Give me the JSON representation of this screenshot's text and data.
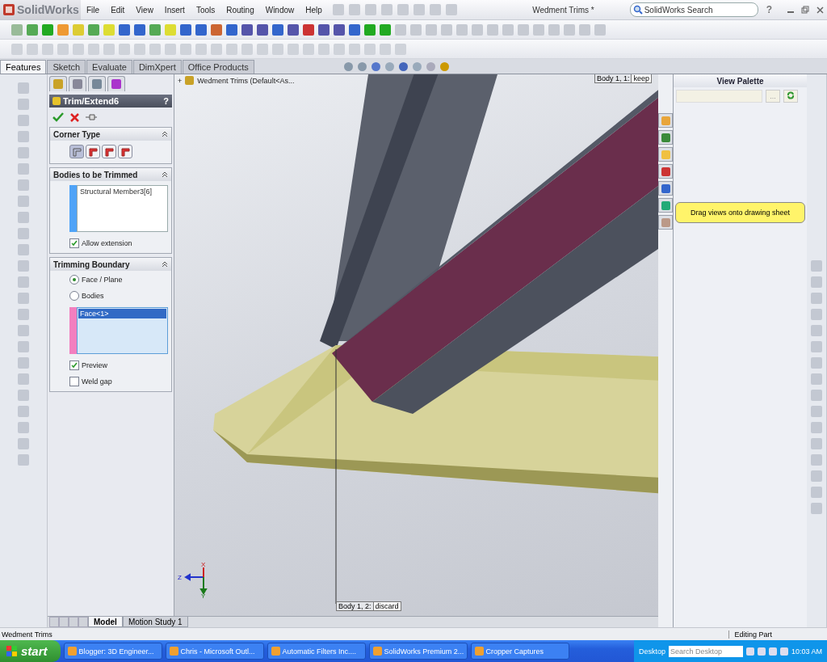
{
  "app": {
    "logo": "SolidWorks",
    "title": "Wedment Trims *",
    "search_placeholder": "SolidWorks Search",
    "help": "?"
  },
  "menu": [
    "File",
    "Edit",
    "View",
    "Insert",
    "Tools",
    "Routing",
    "Window",
    "Help"
  ],
  "command_tabs": [
    {
      "label": "Features",
      "selected": true
    },
    {
      "label": "Sketch",
      "selected": false
    },
    {
      "label": "Evaluate",
      "selected": false
    },
    {
      "label": "DimXpert",
      "selected": false
    },
    {
      "label": "Office Products",
      "selected": false
    }
  ],
  "property_manager": {
    "title": "Trim/Extend6",
    "help": "?",
    "sections": [
      {
        "kind": "corner_type",
        "title": "Corner Type",
        "options": [
          {
            "selected": true
          },
          {
            "selected": false
          },
          {
            "selected": false
          },
          {
            "selected": false
          }
        ]
      },
      {
        "kind": "bodies",
        "title": "Bodies to be Trimmed",
        "color": "#4fa3f7",
        "items": [
          {
            "label": "Structural Member3[6]",
            "selected": false
          }
        ],
        "checkboxes": [
          {
            "label": "Allow extension",
            "checked": true
          }
        ]
      },
      {
        "kind": "boundary",
        "title": "Trimming Boundary",
        "color": "#f27fbf",
        "radios": [
          {
            "label": "Face / Plane",
            "selected": true
          },
          {
            "label": "Bodies",
            "selected": false
          }
        ],
        "items": [
          {
            "label": "Face<1>",
            "selected": true
          }
        ],
        "checkboxes": [
          {
            "label": "Preview",
            "checked": true
          },
          {
            "label": "Weld gap",
            "checked": false
          }
        ]
      }
    ]
  },
  "feature_tree": {
    "expander": "+",
    "label": "Wedment Trims  (Default<As..."
  },
  "callouts": [
    {
      "label": "Body  1,   1:",
      "value": "keep"
    },
    {
      "label": "Body  1,   2:",
      "value": "discard"
    }
  ],
  "triad": [
    "X",
    "Y",
    "Z"
  ],
  "view_palette": {
    "title": "View Palette",
    "browse": "...",
    "hint": "Drag views onto drawing sheet"
  },
  "bottom_tabs": [
    {
      "label": "Model",
      "selected": true
    },
    {
      "label": "Motion Study 1",
      "selected": false
    }
  ],
  "status_bar": {
    "document": "Wedment Trims",
    "mode": "Editing Part"
  },
  "taskbar": {
    "start": "start",
    "tasks": [
      "Blogger: 3D Engineer...",
      "Chris - Microsoft Outl...",
      "Automatic Filters Inc....",
      "SolidWorks Premium 2...",
      "Cropper Captures"
    ],
    "desktop": "Desktop",
    "search_placeholder": "Search Desktop",
    "clock": "10:03 AM"
  }
}
